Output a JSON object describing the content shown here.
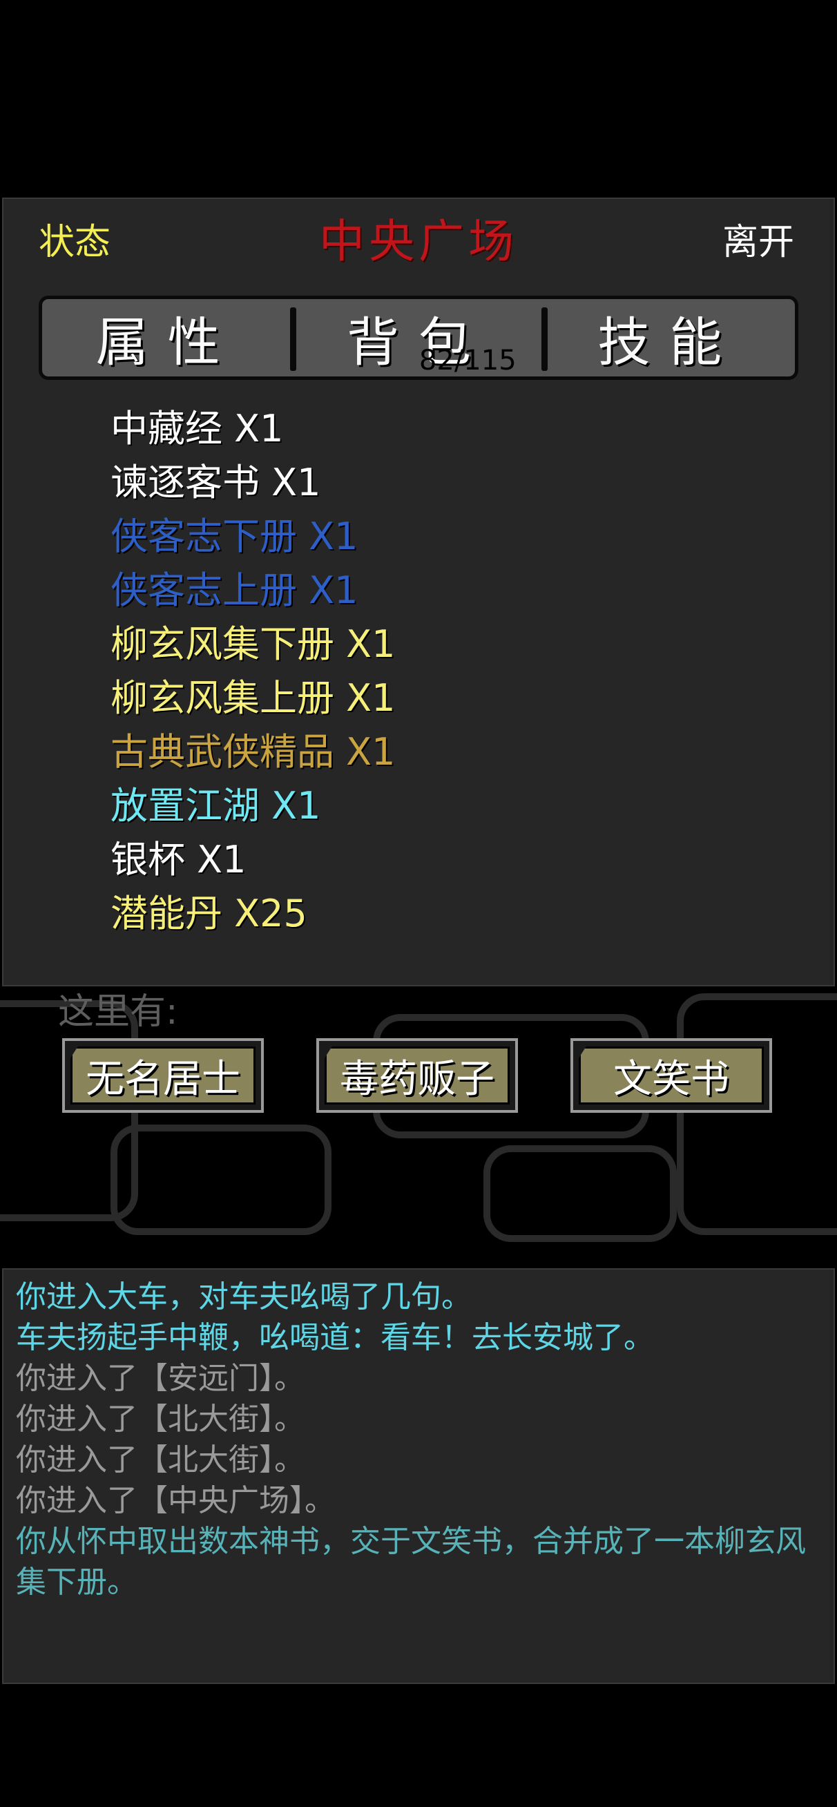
{
  "header": {
    "status_label": "状态",
    "title": "中央广场",
    "leave_label": "离开"
  },
  "tabs": [
    {
      "label": "属性"
    },
    {
      "label": "背包",
      "count": "82/115"
    },
    {
      "label": "技能"
    }
  ],
  "inventory": [
    {
      "name": "中藏经 X1",
      "color": "#ffffff"
    },
    {
      "name": "谏逐客书 X1",
      "color": "#ffffff"
    },
    {
      "name": "侠客志下册 X1",
      "color": "#2e5fc7"
    },
    {
      "name": "侠客志上册 X1",
      "color": "#2e5fc7"
    },
    {
      "name": "柳玄风集下册 X1",
      "color": "#f6f07a"
    },
    {
      "name": "柳玄风集上册 X1",
      "color": "#f6f07a"
    },
    {
      "name": "古典武侠精品 X1",
      "color": "#c9a441"
    },
    {
      "name": "放置江湖 X1",
      "color": "#6fe8f4"
    },
    {
      "name": "银杯 X1",
      "color": "#ffffff"
    },
    {
      "name": "潜能丹 X25",
      "color": "#f6f07a"
    }
  ],
  "here": {
    "label": "这里有:",
    "npcs": [
      "无名居士",
      "毒药贩子",
      "文笑书"
    ]
  },
  "log": [
    {
      "text": "你进入大车，对车夫吆喝了几句。",
      "color": "#5fd6e6"
    },
    {
      "text": "车夫扬起手中鞭，吆喝道：看车！去长安城了。",
      "color": "#5fd6e6"
    },
    {
      "text": "你进入了【安远门】。",
      "color": "#9a9a9a"
    },
    {
      "text": "你进入了【北大街】。",
      "color": "#9a9a9a"
    },
    {
      "text": "你进入了【北大街】。",
      "color": "#9a9a9a"
    },
    {
      "text": "你进入了【中央广场】。",
      "color": "#9a9a9a"
    },
    {
      "text": "你从怀中取出数本神书，交于文笑书，合并成了一本柳玄风集下册。",
      "color": "#58b3b8"
    }
  ]
}
